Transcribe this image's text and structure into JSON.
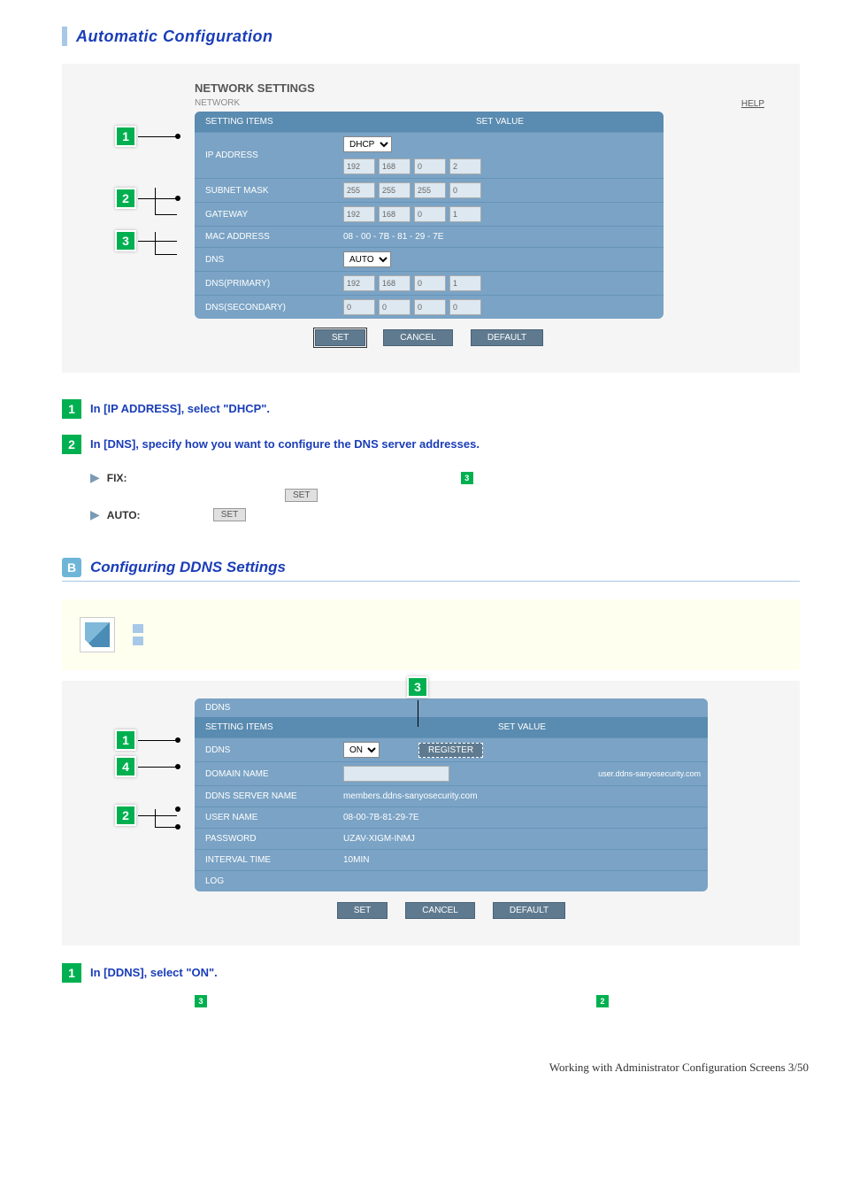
{
  "section_auto": {
    "title": "Automatic Configuration"
  },
  "network_panel": {
    "title": "NETWORK SETTINGS",
    "subtitle": "NETWORK",
    "help": "HELP",
    "header_left": "SETTING ITEMS",
    "header_right": "SET VALUE",
    "rows": {
      "ip_address": {
        "label": "IP ADDRESS",
        "mode": "DHCP",
        "oct": [
          "192",
          "168",
          "0",
          "2"
        ]
      },
      "subnet": {
        "label": "SUBNET MASK",
        "oct": [
          "255",
          "255",
          "255",
          "0"
        ]
      },
      "gateway": {
        "label": "GATEWAY",
        "oct": [
          "192",
          "168",
          "0",
          "1"
        ]
      },
      "mac": {
        "label": "MAC ADDRESS",
        "value": "08 - 00 - 7B - 81 - 29 - 7E"
      },
      "dns": {
        "label": "DNS",
        "mode": "AUTO"
      },
      "dns_primary": {
        "label": "DNS(PRIMARY)",
        "oct": [
          "192",
          "168",
          "0",
          "1"
        ]
      },
      "dns_secondary": {
        "label": "DNS(SECONDARY)",
        "oct": [
          "0",
          "0",
          "0",
          "0"
        ]
      }
    },
    "buttons": {
      "set": "SET",
      "cancel": "CANCEL",
      "default": "DEFAULT"
    }
  },
  "steps_auto": {
    "s1": "In [IP ADDRESS], select \"DHCP\".",
    "s2": "In [DNS], specify how you want to configure the DNS server addresses.",
    "fix": "FIX:",
    "auto": "AUTO:",
    "set_btn": "SET"
  },
  "section_ddns": {
    "letter": "B",
    "title": "Configuring DDNS Settings"
  },
  "ddns_panel": {
    "title": "DDNS",
    "header_left": "SETTING ITEMS",
    "header_right": "SET VALUE",
    "rows": {
      "ddns": {
        "label": "DDNS",
        "mode": "ON",
        "register": "REGISTER"
      },
      "domain": {
        "label": "DOMAIN NAME",
        "value": "",
        "suffix": "user.ddns-sanyosecurity.com"
      },
      "server": {
        "label": "DDNS SERVER NAME",
        "value": "members.ddns-sanyosecurity.com"
      },
      "user": {
        "label": "USER NAME",
        "value": "08-00-7B-81-29-7E"
      },
      "password": {
        "label": "PASSWORD",
        "value": "UZAV-XIGM-INMJ"
      },
      "interval": {
        "label": "INTERVAL TIME",
        "value": "10MIN"
      },
      "log": {
        "label": "LOG",
        "value": ""
      }
    },
    "buttons": {
      "set": "SET",
      "cancel": "CANCEL",
      "default": "DEFAULT"
    }
  },
  "steps_ddns": {
    "s1": "In [DDNS], select \"ON\"."
  },
  "footer": "Working with Administrator Configuration Screens 3/50"
}
